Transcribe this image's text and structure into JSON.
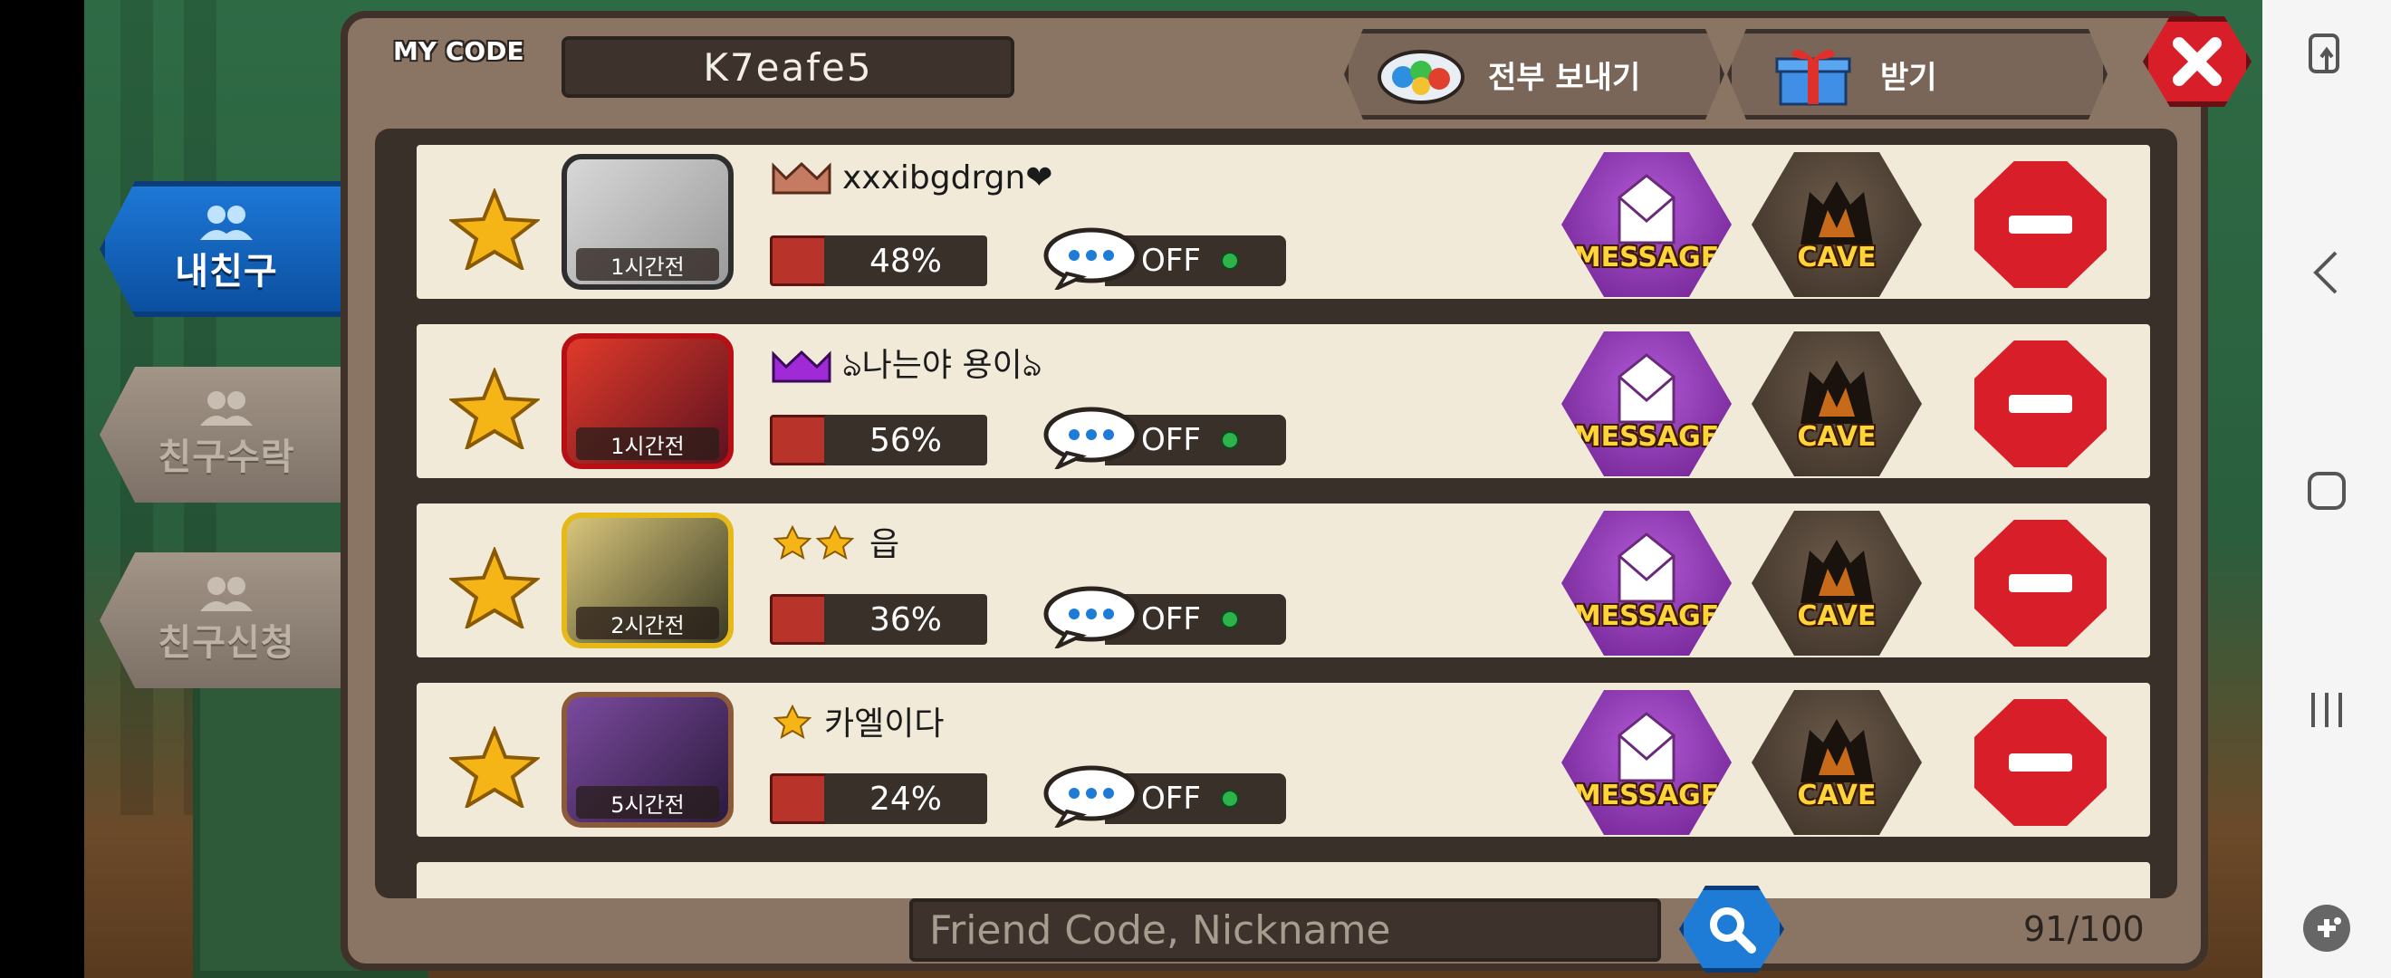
{
  "header": {
    "mycode_label": "MY CODE",
    "mycode_value": "K7eafe5",
    "send_all_label": "전부 보내기",
    "receive_label": "받기"
  },
  "tabs": [
    {
      "label": "내친구",
      "active": true
    },
    {
      "label": "친구수락",
      "active": false
    },
    {
      "label": "친구신청",
      "active": false
    }
  ],
  "friends": [
    {
      "nickname": "xxxibgdrgn❤",
      "rank_icon": "crown-bronze-icon",
      "time": "1시간전",
      "progress": "48%",
      "chat_status": "OFF"
    },
    {
      "nickname": "ঌ나는야 용이ঌ",
      "rank_icon": "crown-purple-icon",
      "time": "1시간전",
      "progress": "56%",
      "chat_status": "OFF"
    },
    {
      "nickname": "읍",
      "rank_icon": "two-stars-icon",
      "time": "2시간전",
      "progress": "36%",
      "chat_status": "OFF"
    },
    {
      "nickname": "카엘이다",
      "rank_icon": "one-star-icon",
      "time": "5시간전",
      "progress": "24%",
      "chat_status": "OFF"
    }
  ],
  "actions": {
    "message_label": "MESSAGE",
    "cave_label": "CAVE"
  },
  "search": {
    "placeholder": "Friend Code, Nickname"
  },
  "friend_count": "91/100",
  "colors": {
    "accent_blue": "#1d78d6",
    "remove_red": "#d81e28",
    "message_purple": "#8a34b0",
    "panel_brown": "#8a7565"
  }
}
